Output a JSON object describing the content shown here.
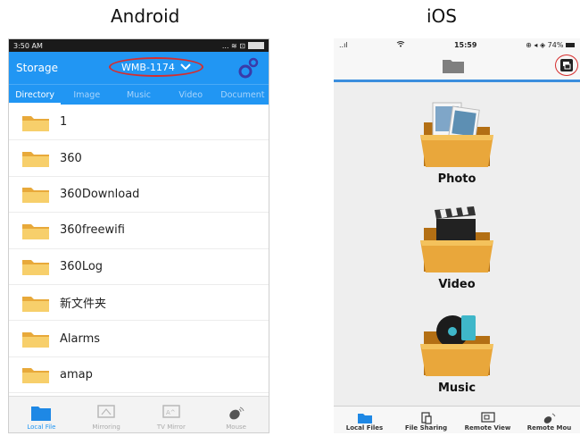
{
  "headings": {
    "android": "Android",
    "ios": "iOS"
  },
  "android": {
    "status_time": "3:50 AM",
    "status_icons": "... ≋ ⊡",
    "app_title": "Storage",
    "device_name": "WMB-1174",
    "tabs": [
      {
        "label": "Directory"
      },
      {
        "label": "Image"
      },
      {
        "label": "Music"
      },
      {
        "label": "Video"
      },
      {
        "label": "Document"
      }
    ],
    "files": [
      {
        "name": "1"
      },
      {
        "name": "360"
      },
      {
        "name": "360Download"
      },
      {
        "name": "360freewifi"
      },
      {
        "name": "360Log"
      },
      {
        "name": "新文件夹"
      },
      {
        "name": "Alarms"
      },
      {
        "name": "amap"
      }
    ],
    "bottom_nav": [
      {
        "label": "Local File",
        "icon": "folder-icon"
      },
      {
        "label": "Mirroring",
        "icon": "mirroring-icon"
      },
      {
        "label": "TV Mirror",
        "icon": "tv-mirror-icon"
      },
      {
        "label": "Mouse",
        "icon": "mouse-icon"
      }
    ],
    "accent": "#2196f3"
  },
  "ios": {
    "status_signal": "..ıl",
    "status_time": "15:59",
    "status_right": "⊕ ◂ ◈ 74%",
    "categories": [
      {
        "label": "Photo",
        "icon": "photo-folder-icon"
      },
      {
        "label": "Video",
        "icon": "video-folder-icon"
      },
      {
        "label": "Music",
        "icon": "music-folder-icon"
      }
    ],
    "bottom_nav": [
      {
        "label": "Local Files",
        "icon": "folder-icon"
      },
      {
        "label": "File Sharing",
        "icon": "file-sharing-icon"
      },
      {
        "label": "Remote View",
        "icon": "remote-view-icon"
      },
      {
        "label": "Remote Mou",
        "icon": "mouse-icon"
      }
    ],
    "accent": "#3b8ede"
  },
  "highlight_color": "#d62d2d"
}
